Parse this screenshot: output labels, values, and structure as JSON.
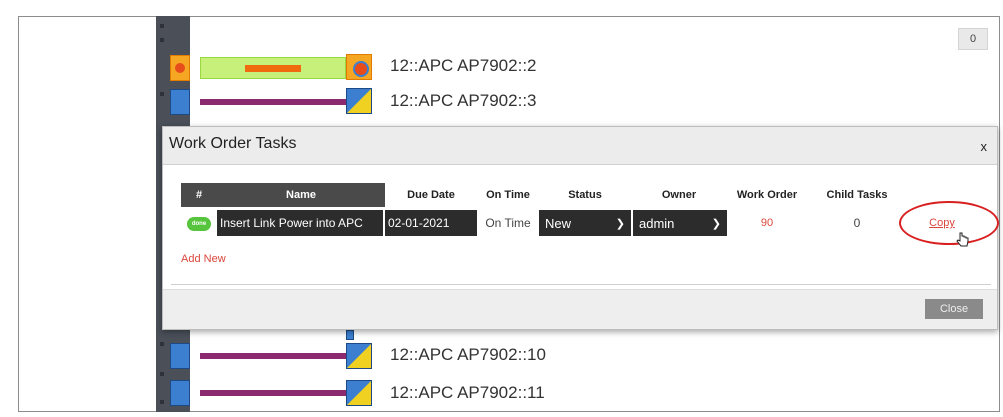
{
  "counter_badge": "0",
  "ports": [
    {
      "label": "12::APC AP7902::2",
      "highlighted": true
    },
    {
      "label": "12::APC AP7902::3",
      "highlighted": false
    },
    {
      "label": "12::APC AP7902::10",
      "highlighted": false
    },
    {
      "label": "12::APC AP7902::11",
      "highlighted": false
    }
  ],
  "colors": {
    "cable": "#8b2a6e",
    "cable_highlight": "#c6f07a",
    "port": "#3c7fd1",
    "accent_red": "#d9463b",
    "status_green": "#56c43c"
  },
  "modal": {
    "title": "Work Order Tasks",
    "close_x": "x",
    "columns": [
      "#",
      "Name",
      "Due Date",
      "On Time",
      "Status",
      "Owner",
      "Work Order",
      "Child Tasks"
    ],
    "rows": [
      {
        "status_pill": "done",
        "name": "Insert Link Power into APC",
        "due_date": "02-01-2021",
        "on_time": "On Time",
        "status": "New",
        "owner": "admin",
        "work_order": "90",
        "child_tasks": "0",
        "action": "Copy"
      }
    ],
    "add_new": "Add New",
    "close_button": "Close"
  }
}
